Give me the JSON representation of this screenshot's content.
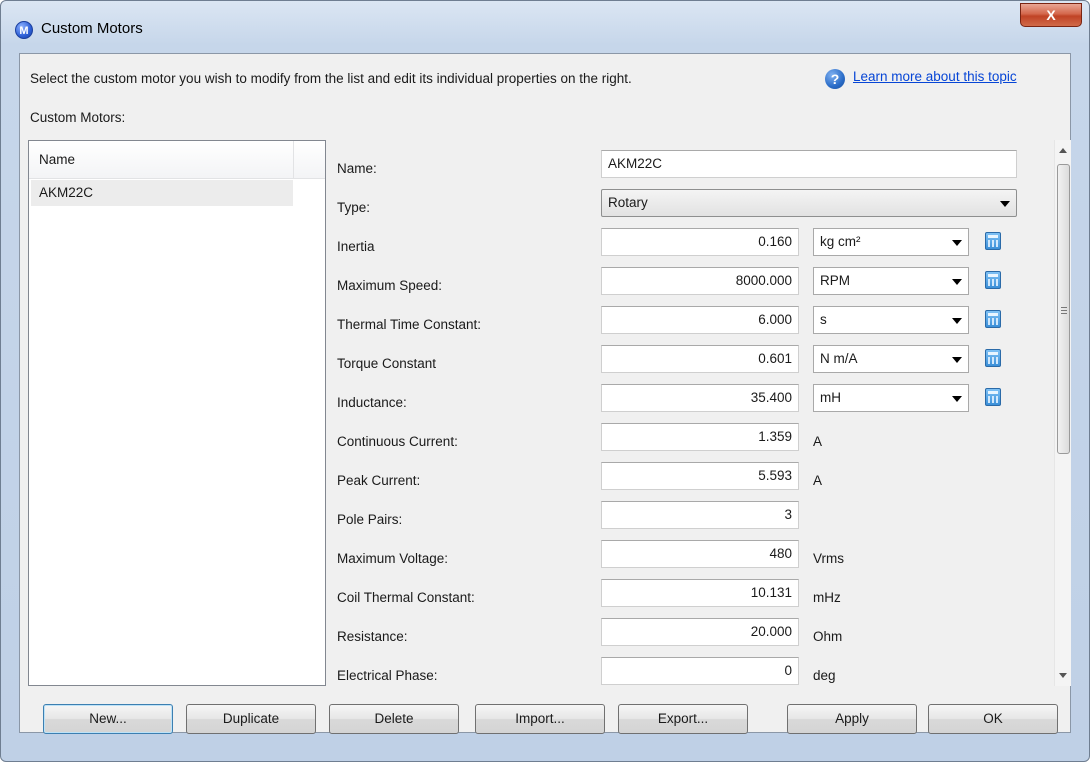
{
  "window": {
    "title": "Custom Motors",
    "close_label": "X"
  },
  "instructions": "Select the custom motor you wish to modify from the list and edit its individual properties on the right.",
  "help_link": "Learn more about this topic",
  "list": {
    "caption": "Custom Motors:",
    "column_header": "Name",
    "items": [
      "AKM22C"
    ]
  },
  "properties": {
    "name": {
      "label": "Name:",
      "value": "AKM22C"
    },
    "type": {
      "label": "Type:",
      "value": "Rotary"
    },
    "inertia": {
      "label": "Inertia",
      "value": "0.160",
      "unit": "kg cm²"
    },
    "max_speed": {
      "label": "Maximum Speed:",
      "value": "8000.000",
      "unit": "RPM"
    },
    "thermal_time_constant": {
      "label": "Thermal Time Constant:",
      "value": "6.000",
      "unit": "s"
    },
    "torque_constant": {
      "label": "Torque Constant",
      "value": "0.601",
      "unit": "N m/A"
    },
    "inductance": {
      "label": "Inductance:",
      "value": "35.400",
      "unit": "mH"
    },
    "continuous_current": {
      "label": "Continuous Current:",
      "value": "1.359",
      "unit": "A"
    },
    "peak_current": {
      "label": "Peak Current:",
      "value": "5.593",
      "unit": "A"
    },
    "pole_pairs": {
      "label": "Pole Pairs:",
      "value": "3"
    },
    "max_voltage": {
      "label": "Maximum Voltage:",
      "value": "480",
      "unit": "Vrms"
    },
    "coil_thermal_constant": {
      "label": "Coil Thermal Constant:",
      "value": "10.131",
      "unit": "mHz"
    },
    "resistance": {
      "label": "Resistance:",
      "value": "20.000",
      "unit": "Ohm"
    },
    "electrical_phase": {
      "label": "Electrical Phase:",
      "value": "0",
      "unit": "deg"
    }
  },
  "buttons": {
    "new": "New...",
    "duplicate": "Duplicate",
    "delete": "Delete",
    "import": "Import...",
    "export": "Export...",
    "apply": "Apply",
    "ok": "OK"
  },
  "icons": {
    "app": "motor-app-icon",
    "help": "help-question-icon",
    "calculator": "calculator-icon"
  },
  "colors": {
    "link": "#0645d6",
    "close_button": "#c04326",
    "default_button_border": "#3c7fb1"
  }
}
